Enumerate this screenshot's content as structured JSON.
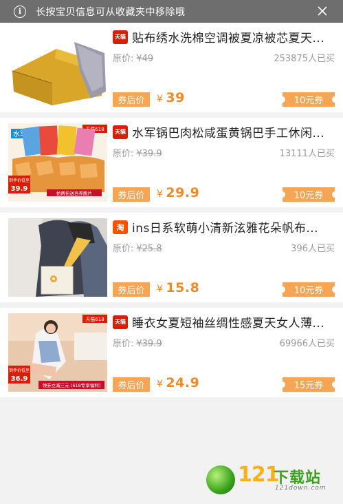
{
  "notice": {
    "text": "长按宝贝信息可从收藏夹中移除哦",
    "info_icon": "info-icon",
    "close_icon": "close-icon"
  },
  "labels": {
    "original_price_label": "原价:",
    "after_coupon_tag": "券后价",
    "currency": "¥"
  },
  "items": [
    {
      "platform": "天猫",
      "platform_type": "tmall",
      "title": "贴布绣水洗棉空调被夏凉被芯夏天...",
      "original_price": "¥49",
      "sold": "253875人已买",
      "final_price": "39",
      "coupon": "10元券",
      "thumb": "yellow-quilt"
    },
    {
      "platform": "天猫",
      "platform_type": "tmall",
      "title": "水军锅巴肉松咸蛋黄锅巴手工休闲...",
      "original_price": "¥39.9",
      "sold": "13111人已买",
      "final_price": "29.9",
      "coupon": "10元券",
      "thumb": "snack-packs",
      "thumb_text": {
        "brand": "水军",
        "tag": "天猫618",
        "promo_label": "到手价低至",
        "promo_price": "39.9",
        "banner": "拍两份送吾养脆片"
      }
    },
    {
      "platform": "淘",
      "platform_type": "taobao",
      "title": "ins日系软萌小清新泫雅花朵帆布...",
      "original_price": "¥25.8",
      "sold": "396人已买",
      "final_price": "15.8",
      "coupon": "10元券",
      "thumb": "canvas-bag"
    },
    {
      "platform": "天猫",
      "platform_type": "tmall",
      "title": "睡衣女夏短袖丝绸性感夏天女人薄...",
      "original_price": "¥39.9",
      "sold": "69966人已买",
      "final_price": "24.9",
      "coupon": "15元券",
      "thumb": "pajamas",
      "thumb_text": {
        "tag": "天猫618",
        "promo_label": "到手价低至",
        "promo_price": "36.9",
        "banner": "领券立减三元 (618专享福利)"
      }
    }
  ],
  "watermark": {
    "number": "121",
    "name": "下载站",
    "url": "121down.com"
  },
  "colors": {
    "notice_bg": "#6e6e6e",
    "accent_orange": "#f5a553",
    "price_orange": "#f08a24",
    "tmall_red": "#d81e06",
    "taobao_orange": "#ff5000",
    "page_bg": "#f2f2f2"
  }
}
